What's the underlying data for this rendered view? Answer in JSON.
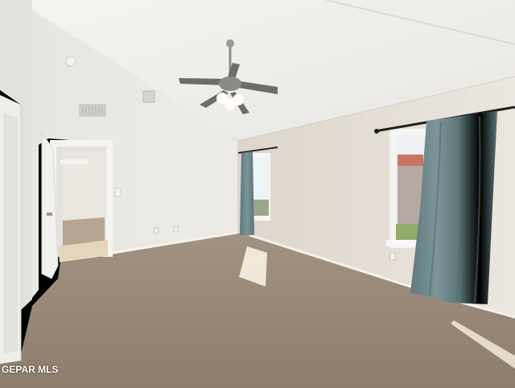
{
  "photo": {
    "subject": "empty-bedroom-interior",
    "watermark": "GEPAR MLS",
    "colors": {
      "wall": "#e6e0d8",
      "ceiling": "#f1f0ed",
      "carpet": "#9a8978",
      "curtain": "#6b8588",
      "baseboard": "#f4f2ee"
    }
  }
}
